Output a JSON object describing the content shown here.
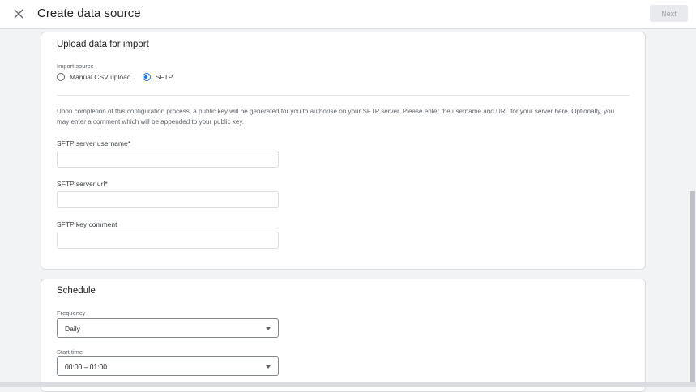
{
  "header": {
    "title": "Create data source",
    "next_label": "Next"
  },
  "upload": {
    "title": "Upload data for import",
    "import_source_label": "Import source",
    "options": [
      {
        "label": "Manual CSV upload",
        "selected": false
      },
      {
        "label": "SFTP",
        "selected": true
      }
    ],
    "description": "Upon completion of this configuration process, a public key will be generated for you to authorise on your SFTP server. Please enter the username and URL for your server here. Optionally, you may enter a comment which will be appended to your public key.",
    "fields": [
      {
        "label": "SFTP server username*",
        "value": "",
        "placeholder": ""
      },
      {
        "label": "SFTP server url*",
        "value": "",
        "placeholder": ""
      },
      {
        "label": "SFTP key comment",
        "value": "",
        "placeholder": ""
      }
    ]
  },
  "schedule": {
    "title": "Schedule",
    "frequency_label": "Frequency",
    "frequency_value": "Daily",
    "start_time_label": "Start time",
    "start_time_value": "00:00 – 01:00"
  },
  "colors": {
    "accent": "#1a73e8",
    "background": "#f1f3f4"
  }
}
